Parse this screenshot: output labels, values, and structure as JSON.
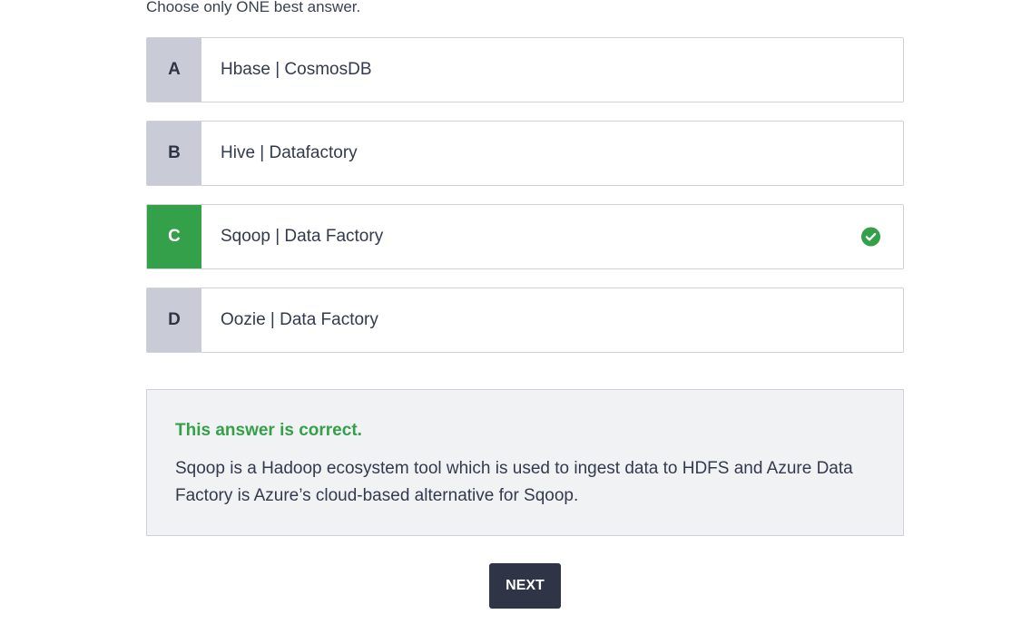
{
  "question": {
    "instruction": "Choose only ONE best answer."
  },
  "options": [
    {
      "letter": "A",
      "text": "Hbase | CosmosDB",
      "state": "default"
    },
    {
      "letter": "B",
      "text": "Hive | Datafactory",
      "state": "default"
    },
    {
      "letter": "C",
      "text": "Sqoop | Data Factory",
      "state": "correct",
      "icon": "check-circle-icon"
    },
    {
      "letter": "D",
      "text": "Oozie | Data Factory",
      "state": "default"
    }
  ],
  "feedback": {
    "verdict": "This answer is correct.",
    "explanation": "Sqoop is a Hadoop ecosystem tool which is used to ingest data to HDFS and Azure Data Factory is Azure’s cloud-based alternative for Sqoop."
  },
  "actions": {
    "next_label": "NEXT"
  },
  "colors": {
    "correct": "#35a04a",
    "letter_bg": "#c9ccd6",
    "button_bg": "#2f3447",
    "feedback_bg": "#f1f2f4"
  }
}
